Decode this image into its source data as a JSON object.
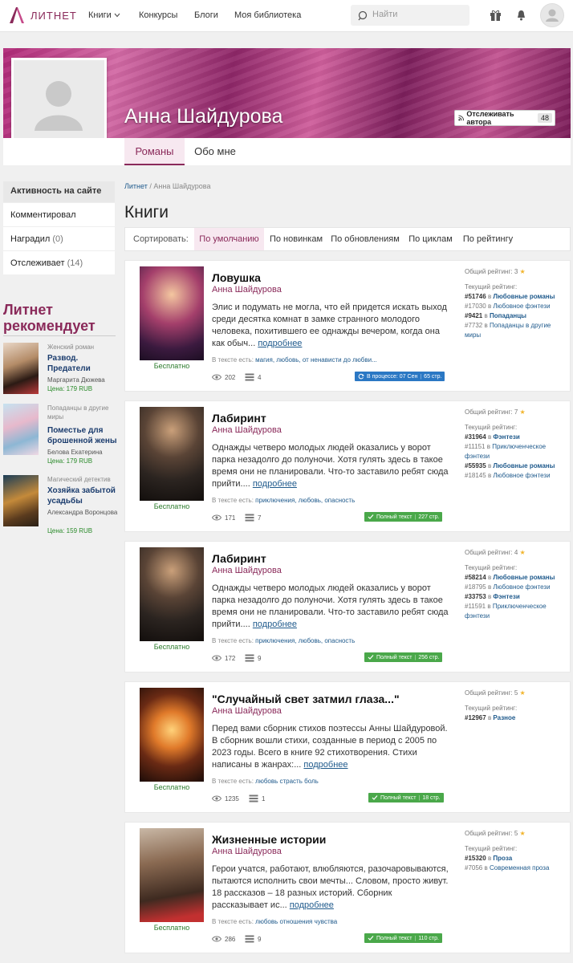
{
  "header": {
    "logo": "ЛИТНЕТ",
    "nav": [
      "Книги",
      "Конкурсы",
      "Блоги",
      "Моя библиотека"
    ],
    "search_placeholder": "Найти"
  },
  "profile": {
    "name": "Анна Шайдурова",
    "follow_label": "Отслеживать автора",
    "follow_count": "48",
    "tabs": [
      "Романы",
      "Обо мне"
    ]
  },
  "sidebar": {
    "heading": "Активность на сайте",
    "items": [
      {
        "label": "Комментировал",
        "count": ""
      },
      {
        "label": "Наградил",
        "count": "(0)"
      },
      {
        "label": "Отслеживает",
        "count": "(14)"
      }
    ],
    "rec_title": "Литнет рекомендует",
    "recs": [
      {
        "genre": "Женский роман",
        "title": "Развод. Предатели",
        "author": "Маргарита Дюжева",
        "price": "Цена: 179 RUB"
      },
      {
        "genre": "Попаданцы в другие миры",
        "title": "Поместье для брошенной жены",
        "author": "Белова Екатерина",
        "price": "Цена: 179 RUB"
      },
      {
        "genre": "Магический детектив",
        "title": "Хозяйка забытой усадьбы",
        "author": "Александра Воронцова",
        "price": "Цена: 159 RUB"
      }
    ]
  },
  "main": {
    "breadcrumb": {
      "root": "Литнет",
      "sep": "/",
      "current": "Анна Шайдурова"
    },
    "heading": "Книги",
    "sort_label": "Сортировать:",
    "sort_options": [
      "По умолчанию",
      "По новинкам",
      "По обновлениям",
      "По циклам",
      "По рейтингу"
    ]
  },
  "books": [
    {
      "title": "Ловушка",
      "author": "Анна Шайдурова",
      "free": "Бесплатно",
      "desc": "Элис и подумать не могла, что ей придется искать выход среди десятка комнат в замке странного молодого человека, похитившего ее однажды вечером, когда она как обыч...",
      "more": "подробнее",
      "tags_label": "В тексте есть:",
      "tags": "магия, любовь, от ненависти до любви...",
      "views": "202",
      "comments": "4",
      "status": "В процессе: 07 Сен",
      "pages": "65 стр.",
      "rating_label": "Общий рейтинг:",
      "rating": "3",
      "current_label": "Текущий рейтинг:",
      "ranks": [
        {
          "num": "#51746",
          "in": "в",
          "cat": "Любовные романы",
          "bold": true
        },
        {
          "num": "#17030",
          "in": "в",
          "cat": "Любовное фэнтези",
          "bold": false
        },
        {
          "num": "#9421",
          "in": "в",
          "cat": "Попаданцы",
          "bold": true
        },
        {
          "num": "#7732",
          "in": "в",
          "cat": "Попаданцы в другие миры",
          "bold": false
        }
      ]
    },
    {
      "title": "Лабиринт",
      "author": "Анна Шайдурова",
      "free": "Бесплатно",
      "desc": "Однажды четверо молодых людей оказались у ворот парка незадолго до полуночи. Хотя гулять здесь в такое время они не планировали. Что-то заставило ребят сюда прийти....",
      "more": "подробнее",
      "tags_label": "В тексте есть:",
      "tags": "приключения, любовь, опасность",
      "views": "171",
      "comments": "7",
      "status": "Полный текст",
      "pages": "227 стр.",
      "rating_label": "Общий рейтинг:",
      "rating": "7",
      "current_label": "Текущий рейтинг:",
      "ranks": [
        {
          "num": "#31964",
          "in": "в",
          "cat": "Фэнтези",
          "bold": true
        },
        {
          "num": "#11151",
          "in": "в",
          "cat": "Приключенческое фэнтези",
          "bold": false
        },
        {
          "num": "#55935",
          "in": "в",
          "cat": "Любовные романы",
          "bold": true
        },
        {
          "num": "#18145",
          "in": "в",
          "cat": "Любовное фэнтези",
          "bold": false
        }
      ]
    },
    {
      "title": "Лабиринт",
      "author": "Анна Шайдурова",
      "free": "Бесплатно",
      "desc": "Однажды четверо молодых людей оказались у ворот парка незадолго до полуночи. Хотя гулять здесь в такое время они не планировали. Что-то заставило ребят сюда прийти....",
      "more": "подробнее",
      "tags_label": "В тексте есть:",
      "tags": "приключения, любовь, опасность",
      "views": "172",
      "comments": "9",
      "status": "Полный текст",
      "pages": "256 стр.",
      "rating_label": "Общий рейтинг:",
      "rating": "4",
      "current_label": "Текущий рейтинг:",
      "ranks": [
        {
          "num": "#58214",
          "in": "в",
          "cat": "Любовные романы",
          "bold": true
        },
        {
          "num": "#18795",
          "in": "в",
          "cat": "Любовное фэнтези",
          "bold": false
        },
        {
          "num": "#33753",
          "in": "в",
          "cat": "Фэнтези",
          "bold": true
        },
        {
          "num": "#11591",
          "in": "в",
          "cat": "Приключенческое фэнтези",
          "bold": false
        }
      ]
    },
    {
      "title": "\"Случайный свет затмил глаза...\"",
      "author": "Анна Шайдурова",
      "free": "Бесплатно",
      "desc": "Перед вами сборник стихов поэтессы Анны Шайдуровой. В сборник вошли стихи, созданные в период с 2005 по 2023 годы. Всего в книге 92 стихотворения. Стихи написаны в жанрах:...",
      "more": "подробнее",
      "tags_label": "В тексте есть:",
      "tags": "любовь страсть боль",
      "views": "1235",
      "comments": "1",
      "status": "Полный текст",
      "pages": "18 стр.",
      "rating_label": "Общий рейтинг:",
      "rating": "5",
      "current_label": "Текущий рейтинг:",
      "ranks": [
        {
          "num": "#12967",
          "in": "в",
          "cat": "Разное",
          "bold": true
        }
      ]
    },
    {
      "title": "Жизненные истории",
      "author": "Анна Шайдурова",
      "free": "Бесплатно",
      "desc": "Герои учатся, работают, влюбляются, разочаровываются, пытаются исполнить свои мечты... Словом, просто живут. 18 рассказов – 18 разных историй. Сборник рассказывает ис...",
      "more": "подробнее",
      "tags_label": "В тексте есть:",
      "tags": "любовь отношения чувства",
      "views": "286",
      "comments": "9",
      "status": "Полный текст",
      "pages": "110 стр.",
      "rating_label": "Общий рейтинг:",
      "rating": "5",
      "current_label": "Текущий рейтинг:",
      "ranks": [
        {
          "num": "#15320",
          "in": "в",
          "cat": "Проза",
          "bold": true
        },
        {
          "num": "#7056",
          "in": "в",
          "cat": "Современная проза",
          "bold": false
        }
      ]
    }
  ],
  "colors": {
    "brand": "#8a2a5a",
    "link": "#1f5a8c",
    "status_progress": "#2b78c4",
    "status_complete": "#4aa84a",
    "star": "#f1b42c"
  },
  "icons": [
    "search-icon",
    "gift-icon",
    "bell-icon",
    "user-icon",
    "rss-icon",
    "eye-icon",
    "comments-icon",
    "check-icon",
    "refresh-icon",
    "star-icon"
  ]
}
